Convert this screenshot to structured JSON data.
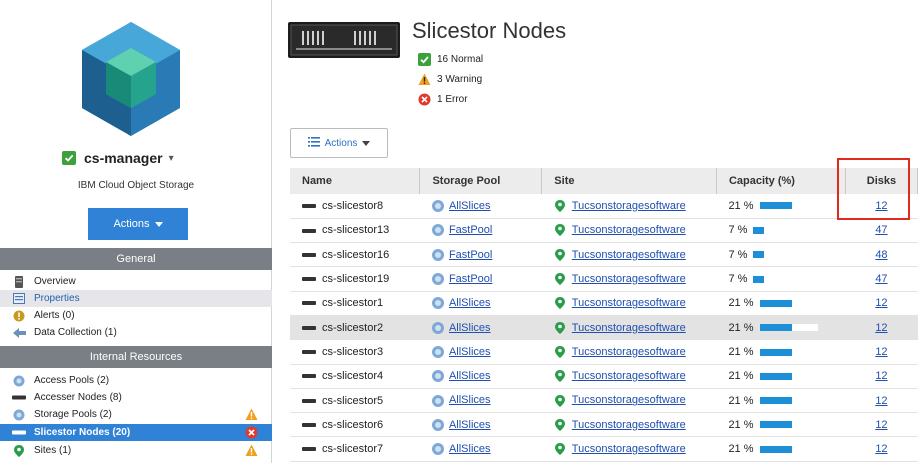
{
  "sidebar": {
    "manager_name": "cs-manager",
    "manager_caret": "▾",
    "manager_subtitle": "IBM Cloud Object Storage",
    "actions_label": "Actions",
    "sections": {
      "general": "General",
      "internal": "Internal Resources"
    },
    "general_items": [
      {
        "label": "Overview",
        "icon": "server-icon"
      },
      {
        "label": "Properties",
        "icon": "properties-icon"
      },
      {
        "label": "Alerts (0)",
        "icon": "alert-icon"
      },
      {
        "label": "Data Collection (1)",
        "icon": "data-collection-icon"
      }
    ],
    "internal_items": [
      {
        "label": "Access Pools (2)",
        "icon": "access-pool-icon"
      },
      {
        "label": "Accesser Nodes (8)",
        "icon": "server-icon"
      },
      {
        "label": "Storage Pools (2)",
        "icon": "storage-pool-icon",
        "status": "warning"
      },
      {
        "label": "Slicestor Nodes (20)",
        "icon": "server-icon",
        "status": "error"
      },
      {
        "label": "Sites (1)",
        "icon": "location-pin-icon",
        "status": "warning"
      }
    ]
  },
  "header": {
    "title": "Slicestor Nodes",
    "status_normal": "16 Normal",
    "status_warning": "3 Warning",
    "status_error": "1 Error"
  },
  "table": {
    "actions_label": "Actions",
    "columns": [
      "Name",
      "Storage Pool",
      "Site",
      "Capacity (%)",
      "Disks"
    ],
    "rows": [
      {
        "name": "cs-slicestor8",
        "pool": "AllSlices",
        "site": "Tucsonstoragesoftware",
        "capacity": "21 %",
        "cap_pct": 21,
        "disks": "12"
      },
      {
        "name": "cs-slicestor13",
        "pool": "FastPool",
        "site": "Tucsonstoragesoftware",
        "capacity": "7 %",
        "cap_pct": 7,
        "disks": "47"
      },
      {
        "name": "cs-slicestor16",
        "pool": "FastPool",
        "site": "Tucsonstoragesoftware",
        "capacity": "7 %",
        "cap_pct": 7,
        "disks": "48"
      },
      {
        "name": "cs-slicestor19",
        "pool": "FastPool",
        "site": "Tucsonstoragesoftware",
        "capacity": "7 %",
        "cap_pct": 7,
        "disks": "47"
      },
      {
        "name": "cs-slicestor1",
        "pool": "AllSlices",
        "site": "Tucsonstoragesoftware",
        "capacity": "21 %",
        "cap_pct": 21,
        "disks": "12"
      },
      {
        "name": "cs-slicestor2",
        "pool": "AllSlices",
        "site": "Tucsonstoragesoftware",
        "capacity": "21 %",
        "cap_pct": 21,
        "disks": "12",
        "highlight": true
      },
      {
        "name": "cs-slicestor3",
        "pool": "AllSlices",
        "site": "Tucsonstoragesoftware",
        "capacity": "21 %",
        "cap_pct": 21,
        "disks": "12"
      },
      {
        "name": "cs-slicestor4",
        "pool": "AllSlices",
        "site": "Tucsonstoragesoftware",
        "capacity": "21 %",
        "cap_pct": 21,
        "disks": "12"
      },
      {
        "name": "cs-slicestor5",
        "pool": "AllSlices",
        "site": "Tucsonstoragesoftware",
        "capacity": "21 %",
        "cap_pct": 21,
        "disks": "12"
      },
      {
        "name": "cs-slicestor6",
        "pool": "AllSlices",
        "site": "Tucsonstoragesoftware",
        "capacity": "21 %",
        "cap_pct": 21,
        "disks": "12"
      },
      {
        "name": "cs-slicestor7",
        "pool": "AllSlices",
        "site": "Tucsonstoragesoftware",
        "capacity": "21 %",
        "cap_pct": 21,
        "disks": "12"
      }
    ]
  },
  "colors": {
    "accent": "#2f82d6",
    "normal": "#3ca03c",
    "warning": "#f0a020",
    "error": "#e03a30",
    "highlight_box": "#e02a20"
  }
}
